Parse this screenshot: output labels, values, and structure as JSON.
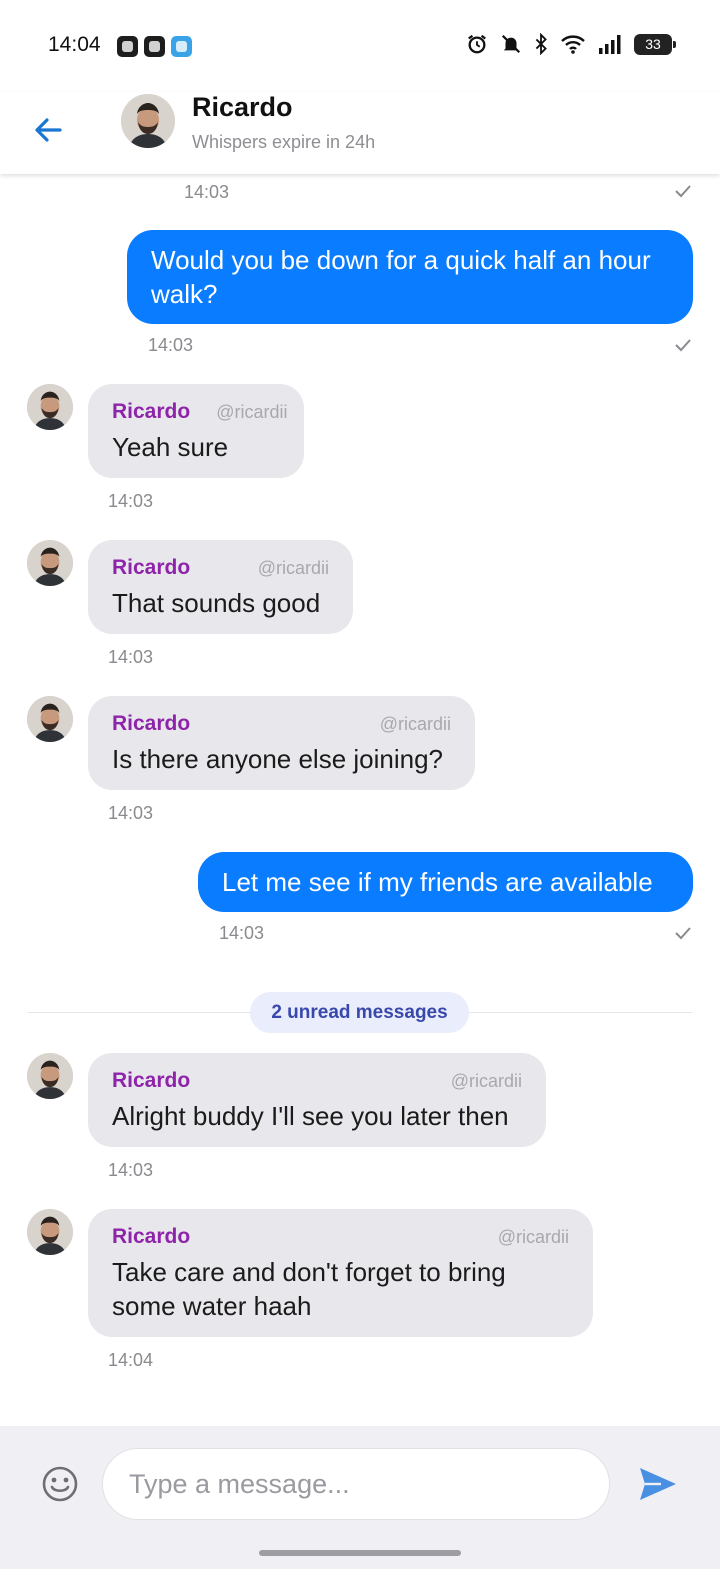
{
  "status_bar": {
    "time": "14:04",
    "battery": "33"
  },
  "header": {
    "contact_name": "Ricardo",
    "subtitle": "Whispers expire in 24h"
  },
  "messages": [
    {
      "dir": "out",
      "time": "14:03",
      "status_icon": "check-icon"
    },
    {
      "dir": "out",
      "text": "Would you be down for a quick half an hour walk?",
      "time": "14:03",
      "status_icon": "check-icon"
    },
    {
      "dir": "in",
      "name": "Ricardo",
      "handle": "@ricardii",
      "text": "Yeah sure",
      "time": "14:03"
    },
    {
      "dir": "in",
      "name": "Ricardo",
      "handle": "@ricardii",
      "text": "That sounds good",
      "time": "14:03"
    },
    {
      "dir": "in",
      "name": "Ricardo",
      "handle": "@ricardii",
      "text": "Is there anyone else joining?",
      "time": "14:03"
    },
    {
      "dir": "out",
      "text": "Let me see if my friends are available",
      "time": "14:03",
      "status_icon": "check-icon"
    },
    {
      "dir": "in",
      "name": "Ricardo",
      "handle": "@ricardii",
      "text": "Alright buddy I'll see you later then",
      "time": "14:03"
    },
    {
      "dir": "in",
      "name": "Ricardo",
      "handle": "@ricardii",
      "text": "Take care and don't forget to bring some water haah",
      "time": "14:04"
    }
  ],
  "unread_divider": "2 unread messages",
  "composer": {
    "placeholder": "Type a message..."
  },
  "colors": {
    "outgoing_bubble": "#0a7cff",
    "incoming_bubble": "#e8e8ec",
    "sender_name": "#8e24aa",
    "accent": "#1976d2",
    "send_icon": "#4a90e2"
  }
}
